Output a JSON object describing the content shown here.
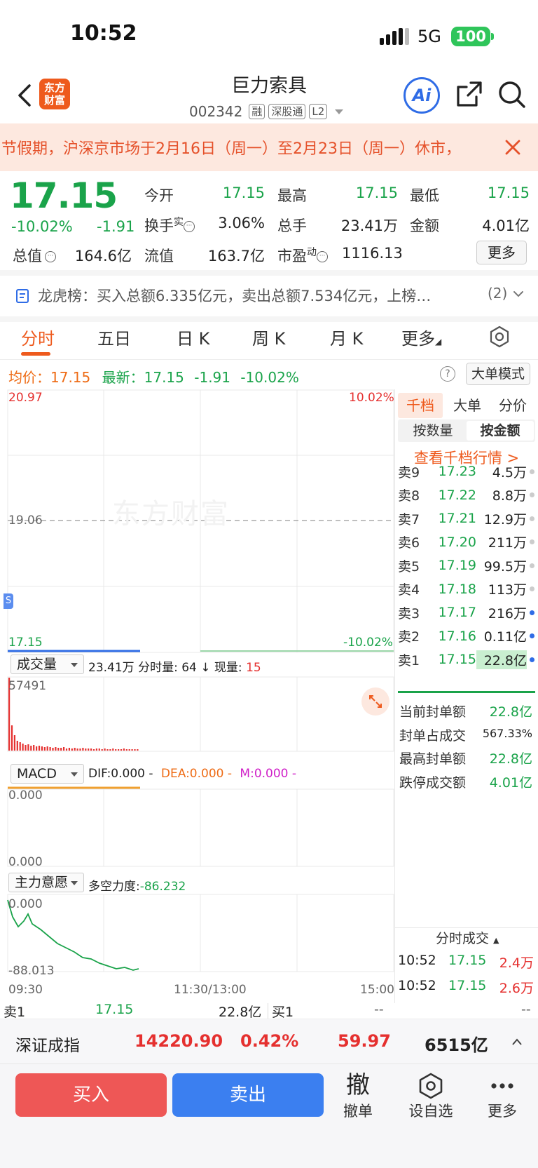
{
  "status": {
    "time": "10:52",
    "network": "5G",
    "battery": "100"
  },
  "header": {
    "logo_line1": "东方",
    "logo_line2": "财富",
    "name": "巨力索具",
    "code": "002342",
    "tags": [
      "融",
      "深股通",
      "L2"
    ],
    "ai_label": "Ai"
  },
  "notice": {
    "text": "节假期，沪深京市场于2月16日（周一）至2月23日（周一）休市，"
  },
  "quote": {
    "price": "17.15",
    "change_pct": "-10.02%",
    "change": "-1.91",
    "open_label": "今开",
    "open": "17.15",
    "high_label": "最高",
    "high": "17.15",
    "low_label": "最低",
    "low": "17.15",
    "turnover_label": "换手",
    "turnover_sup": "实",
    "turnover": "3.06%",
    "volume_label": "总手",
    "volume": "23.41万",
    "amount_label": "金额",
    "amount": "4.01亿",
    "mktcap_label": "总值",
    "mktcap": "164.6亿",
    "float_label": "流值",
    "float": "163.7亿",
    "pe_label": "市盈",
    "pe_sup": "动",
    "pe": "1116.13",
    "more": "更多"
  },
  "dragon_tiger": {
    "text": "龙虎榜：买入总额6.335亿元，卖出总额7.534亿元，上榜…",
    "count": "(2)"
  },
  "tabs": [
    "分时",
    "五日",
    "日 K",
    "周 K",
    "月 K",
    "更多"
  ],
  "price_line": {
    "avg_label": "均价：",
    "avg": "17.15",
    "latest_label": "最新：",
    "latest": "17.15",
    "change": "-1.91",
    "change_pct": "-10.02%",
    "help": "?",
    "big_order_mode": "大单模式"
  },
  "intraday": {
    "y_top": "20.97",
    "y_mid": "19.06",
    "y_bottom": "17.15",
    "pct_top": "10.02%",
    "pct_bottom": "-10.02%",
    "watermark": "东方财富",
    "marker": "S"
  },
  "volume_panel": {
    "selector": "成交量",
    "total": "23.41万",
    "minute_label": "分时量:",
    "minute": "64",
    "current_label": "现量:",
    "current": "15",
    "max": "57491"
  },
  "macd_panel": {
    "selector": "MACD",
    "dif": "DIF:0.000 -",
    "dea": "DEA:0.000 -",
    "m": "M:0.000 -",
    "y_top": "0.000",
    "y_bottom": "0.000"
  },
  "main_force_panel": {
    "selector": "主力意愿",
    "label": "多空力度:",
    "value": "-86.232",
    "y_top": "0.000",
    "y_bottom": "-88.013"
  },
  "time_axis": {
    "start": "09:30",
    "mid": "11:30/13:00",
    "end": "15:00"
  },
  "right_panel": {
    "tabs": [
      "千档",
      "大单",
      "分价"
    ],
    "subtabs": [
      "按数量",
      "按金额"
    ],
    "view_link": "查看千档行情 >",
    "orders": [
      {
        "label": "卖9",
        "price": "17.23",
        "vol": "4.5万"
      },
      {
        "label": "卖8",
        "price": "17.22",
        "vol": "8.8万"
      },
      {
        "label": "卖7",
        "price": "17.21",
        "vol": "12.9万"
      },
      {
        "label": "卖6",
        "price": "17.20",
        "vol": "211万"
      },
      {
        "label": "卖5",
        "price": "17.19",
        "vol": "99.5万"
      },
      {
        "label": "卖4",
        "price": "17.18",
        "vol": "113万"
      },
      {
        "label": "卖3",
        "price": "17.17",
        "vol": "216万"
      },
      {
        "label": "卖2",
        "price": "17.16",
        "vol": "0.11亿"
      },
      {
        "label": "卖1",
        "price": "17.15",
        "vol": "22.8亿"
      }
    ],
    "stats": [
      {
        "label": "当前封单额",
        "value": "22.8亿"
      },
      {
        "label": "封单占成交",
        "value": "567.33%"
      },
      {
        "label": "最高封单额",
        "value": "22.8亿"
      },
      {
        "label": "跌停成交额",
        "value": "4.01亿"
      }
    ],
    "ticks_title": "分时成交",
    "ticks": [
      {
        "time": "10:52",
        "price": "17.15",
        "vol": "2.4万"
      },
      {
        "time": "10:52",
        "price": "17.15",
        "vol": "2.6万"
      }
    ]
  },
  "bid_ask": {
    "sell_label": "卖1",
    "sell_price": "17.15",
    "sell_vol": "22.8亿",
    "buy_label": "买1",
    "buy_price": "--",
    "buy_vol": "--"
  },
  "index_bar": {
    "name": "深证成指",
    "value": "14220.90",
    "pct": "0.42%",
    "change": "59.97",
    "amount": "6515亿"
  },
  "actions": {
    "buy": "买入",
    "sell": "卖出",
    "cancel_icon": "撤",
    "cancel": "撤单",
    "watch": "设自选",
    "more": "更多"
  },
  "colors": {
    "up": "#e5302f",
    "down": "#1aa34a",
    "accent": "#ee5a1d",
    "blue": "#2f6ce6"
  }
}
